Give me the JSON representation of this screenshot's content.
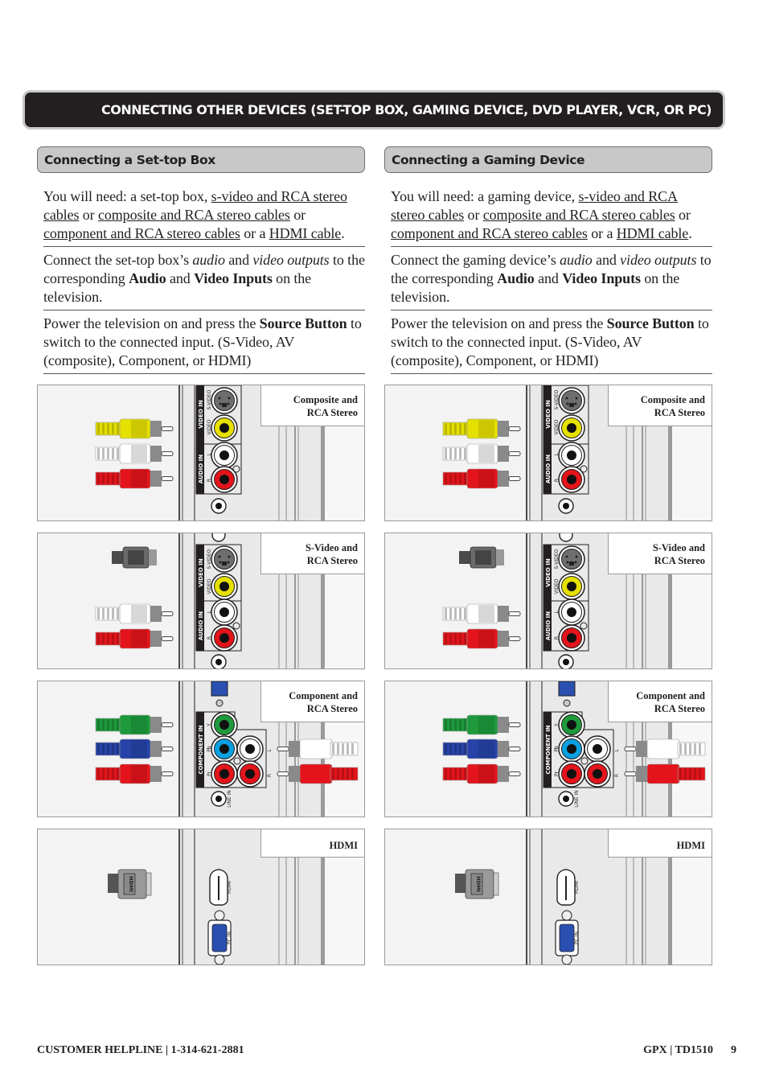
{
  "page_header": {
    "title": "CONNECTING OTHER DEVICES (SET-TOP BOX, GAMING DEVICE, DVD PLAYER, VCR, OR PC)"
  },
  "sections": [
    {
      "title": "Connecting a Set-top Box",
      "need_intro": "You  will need: a set-top box, ",
      "need_links": [
        "s-video and RCA stereo cables",
        "composite and RCA stereo cables",
        "component and RCA stereo cables",
        "HDMI cable"
      ],
      "need_or1": " or ",
      "need_or2": " or ",
      "need_or3": " or a ",
      "need_end": ".",
      "connect_prefix": "Connect the set-top box’s ",
      "connect_audio": "audio",
      "connect_and": " and ",
      "connect_video": "video outputs",
      "connect_mid": " to the corresponding ",
      "connect_audio_bold": "Audio",
      "connect_and2": " and ",
      "connect_video_bold": "Video Inputs",
      "connect_suffix": " on the television.",
      "power_prefix": "Power the television on and press the ",
      "power_bold": "Source Button",
      "power_suffix": " to switch to the connected input. (S-Video, AV (composite), Component, or HDMI)"
    },
    {
      "title": "Connecting a Gaming Device",
      "need_intro": "You  will need: a gaming device, ",
      "need_links": [
        "s-video and RCA stereo cables",
        "composite and RCA stereo cables",
        "component and RCA stereo cables",
        "HDMI cable"
      ],
      "need_or1": " or ",
      "need_or2": " or ",
      "need_or3": " or a ",
      "need_end": ".",
      "connect_prefix": "Connect the gaming device’s ",
      "connect_audio": "audio",
      "connect_and": " and ",
      "connect_video": "video outputs",
      "connect_mid": " to the corresponding ",
      "connect_audio_bold": "Audio",
      "connect_and2": " and ",
      "connect_video_bold": "Video Inputs",
      "connect_suffix": " on the television.",
      "power_prefix": "Power the television on and press the ",
      "power_bold": "Source Button",
      "power_suffix": " to switch to the connected input. (S-Video, AV (composite), Component, or HDMI)"
    }
  ],
  "diagrams": [
    {
      "type": "composite",
      "label_line1": "Composite and",
      "label_line2": "RCA Stereo"
    },
    {
      "type": "svideo",
      "label_line1": "S-Video and",
      "label_line2": "RCA Stereo"
    },
    {
      "type": "component",
      "label_line1": "Component and",
      "label_line2": "RCA Stereo"
    },
    {
      "type": "hdmi",
      "label_line1": "HDMI",
      "label_line2": ""
    }
  ],
  "panel_labels": {
    "video_in": "VIDEO IN",
    "audio_in": "AUDIO IN",
    "component_in": "COMPONENT IN",
    "svideo": "S-VIDEO",
    "video": "VIDEO",
    "l": "L",
    "r": "R",
    "y": "Y",
    "pb": "Pb",
    "pr": "Pr",
    "line_in": "LINE IN",
    "hdmi": "HDMI",
    "pc_in": "PC IN",
    "plug_hdmi": "HDMI"
  },
  "colors": {
    "yellow": "#e5e000",
    "white": "#ffffff",
    "red": "#e3141b",
    "green": "#1e9a3c",
    "blue": "#2743a8",
    "cyan": "#0aa0e0",
    "vga_blue": "#2a4fb0"
  },
  "footer": {
    "left": "CUSTOMER HELPLINE  |  1-314-621-2881",
    "right": "GPX  |  TD1510",
    "page_number": "9"
  }
}
